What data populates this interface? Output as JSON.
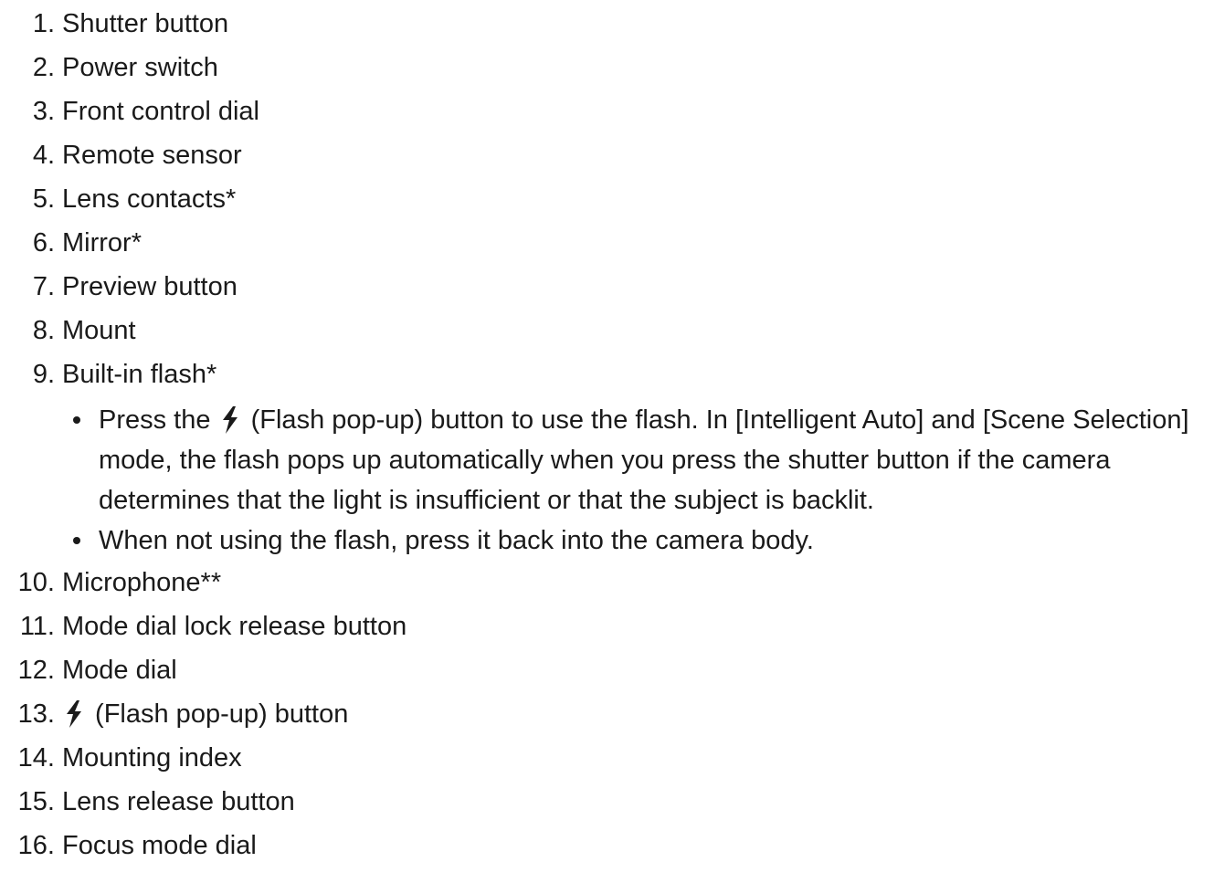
{
  "items": [
    {
      "num": "1.",
      "label": "Shutter button"
    },
    {
      "num": "2.",
      "label": "Power switch"
    },
    {
      "num": "3.",
      "label": "Front control dial"
    },
    {
      "num": "4.",
      "label": "Remote sensor"
    },
    {
      "num": "5.",
      "label": "Lens contacts*"
    },
    {
      "num": "6.",
      "label": "Mirror*"
    },
    {
      "num": "7.",
      "label": "Preview button"
    },
    {
      "num": "8.",
      "label": "Mount"
    },
    {
      "num": "9.",
      "label": "Built-in flash*"
    },
    {
      "num": "10.",
      "label": "Microphone**"
    },
    {
      "num": "11.",
      "label": "Mode dial lock release button"
    },
    {
      "num": "12.",
      "label": "Mode dial"
    },
    {
      "num": "13.",
      "label": " (Flash pop-up) button"
    },
    {
      "num": "14.",
      "label": "Mounting index"
    },
    {
      "num": "15.",
      "label": "Lens release button"
    },
    {
      "num": "16.",
      "label": "Focus mode dial"
    }
  ],
  "flash_notes": {
    "note1_before": "Press the ",
    "note1_after": " (Flash pop-up) button to use the flash. In [Intelligent Auto] and [Scene Selection] mode, the flash pops up automatically when you press the shutter button if the camera determines that the light is insufficient or that the subject is backlit.",
    "note2": "When not using the flash, press it back into the camera body."
  },
  "icons": {
    "flash": "flash-icon"
  },
  "colors": {
    "text": "#1a1a1a",
    "background": "#ffffff"
  }
}
